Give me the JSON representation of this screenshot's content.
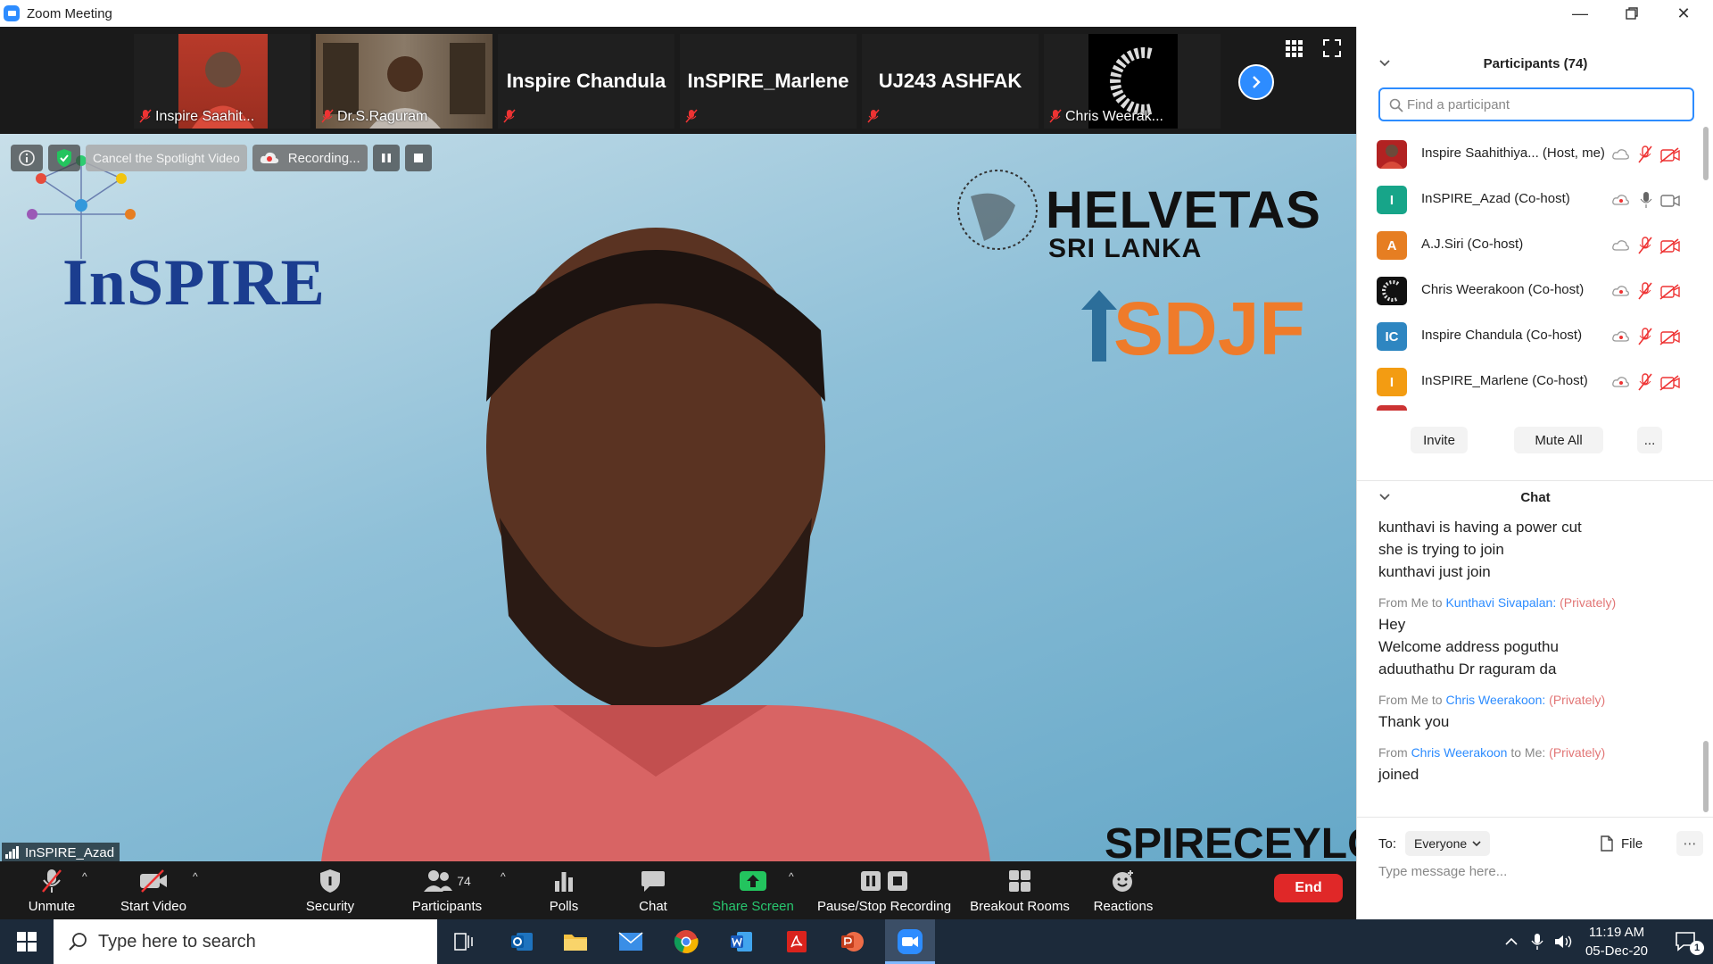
{
  "window": {
    "title": "Zoom Meeting"
  },
  "strip": {
    "tiles": [
      {
        "name": "Inspire Saahit..."
      },
      {
        "name": "Dr.S.Raguram"
      },
      {
        "name": "Inspire Chandula"
      },
      {
        "name": "InSPIRE_Marlene"
      },
      {
        "name": "UJ243 ASHFAK"
      },
      {
        "name": "Chris Weerak..."
      }
    ]
  },
  "video": {
    "spotlight_label": "Cancel the Spotlight Video",
    "recording_label": "Recording...",
    "speaker_name": "InSPIRE_Azad",
    "logo_inspire": "InSPIRE",
    "logo_helvetas": "HELVETAS",
    "logo_srilanka": "SRI LANKA",
    "logo_sdjf": "SDJF",
    "banner_text": "SPIRECEYLON"
  },
  "toolbar": {
    "unmute": "Unmute",
    "start_video": "Start Video",
    "security": "Security",
    "participants": "Participants",
    "participants_count": "74",
    "polls": "Polls",
    "chat": "Chat",
    "share_screen": "Share Screen",
    "pause_stop": "Pause/Stop Recording",
    "breakout": "Breakout Rooms",
    "reactions": "Reactions",
    "end": "End"
  },
  "participants": {
    "header": "Participants (74)",
    "search_placeholder": "Find a participant",
    "list": [
      {
        "name": "Inspire Saahithiya... (Host, me)",
        "initial": "",
        "color": "#b22222"
      },
      {
        "name": "InSPIRE_Azad (Co-host)",
        "initial": "I",
        "color": "#17a589"
      },
      {
        "name": "A.J.Siri (Co-host)",
        "initial": "A",
        "color": "#e67e22"
      },
      {
        "name": "Chris Weerakoon (Co-host)",
        "initial": "",
        "color": "#111111"
      },
      {
        "name": "Inspire Chandula (Co-host)",
        "initial": "IC",
        "color": "#2e86c1"
      },
      {
        "name": "InSPIRE_Marlene (Co-host)",
        "initial": "I",
        "color": "#f39c12"
      }
    ],
    "invite": "Invite",
    "mute_all": "Mute All",
    "more": "..."
  },
  "chat": {
    "header": "Chat",
    "lines_top": [
      "kunthavi is having a power cut",
      "she is trying to join",
      "kunthavi just join"
    ],
    "msg1": {
      "from": "From Me to",
      "to": "Kunthavi Sivapalan:",
      "private": "(Privately)",
      "lines": [
        "Hey",
        "Welcome address poguthu",
        "aduuthathu Dr raguram da"
      ]
    },
    "msg2": {
      "from": "From Me to",
      "to": "Chris Weerakoon:",
      "private": "(Privately)",
      "lines": [
        "Thank you"
      ]
    },
    "msg3": {
      "from": "From",
      "sender": "Chris Weerakoon",
      "to": "to Me:",
      "private": "(Privately)",
      "lines": [
        "joined"
      ]
    },
    "to_label": "To:",
    "to_value": "Everyone",
    "file": "File",
    "placeholder": "Type message here..."
  },
  "taskbar": {
    "search": "Type here to search",
    "time": "11:19 AM",
    "date": "05-Dec-20",
    "notif_count": "1"
  }
}
